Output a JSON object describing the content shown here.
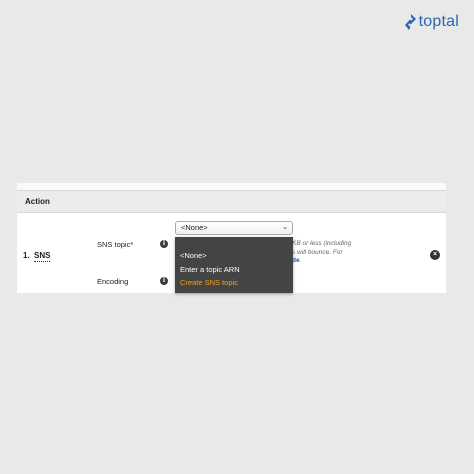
{
  "brand": {
    "name": "toptal",
    "color": "#2a66b2"
  },
  "table": {
    "header": "Action",
    "row": {
      "number": "1.",
      "type": "SNS",
      "fields": [
        {
          "label": "SNS topic*",
          "info_icon": "info-icon"
        },
        {
          "label": "Encoding",
          "info_icon": "info-icon"
        }
      ]
    }
  },
  "select": {
    "value": "<None>",
    "arrow_icon": "chevron-down-icon"
  },
  "dropdown": {
    "options": [
      "<None>",
      "Enter a topic ARN",
      "Create SNS topic"
    ],
    "highlight_color": "#f3a11d"
  },
  "help": {
    "line1": "KB or less (including",
    "line2": "s will bounce. For",
    "link_fragment": "de",
    "trailing": "."
  },
  "remove_icon": "close-circle-icon"
}
